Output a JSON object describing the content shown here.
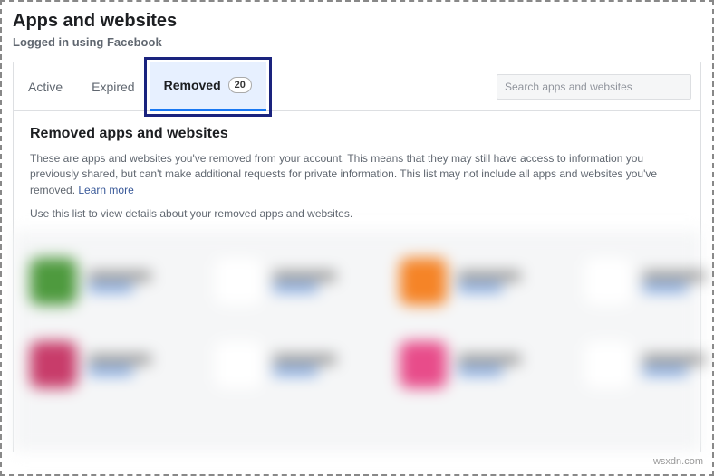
{
  "header": {
    "title": "Apps and websites",
    "subtitle": "Logged in using Facebook"
  },
  "tabs": {
    "active": "Active",
    "expired": "Expired",
    "removed": "Removed",
    "removed_count": "20"
  },
  "search": {
    "placeholder": "Search apps and websites"
  },
  "section": {
    "title": "Removed apps and websites",
    "description": "These are apps and websites you've removed from your account. This means that they may still have access to information you previously shared, but can't make additional requests for private information. This list may not include all apps and websites you've removed.",
    "learn_more": "Learn more",
    "note": "Use this list to view details about your removed apps and websites."
  },
  "apps": {
    "row1_colors": [
      "#4e9a3e",
      "#ffffff",
      "#f58427",
      "#ffffff",
      "#111111",
      "#ffffff"
    ],
    "row2_colors": [
      "#c83c6a",
      "#ffffff",
      "#e84c8a",
      "#ffffff"
    ]
  },
  "watermark": "wsxdn.com"
}
